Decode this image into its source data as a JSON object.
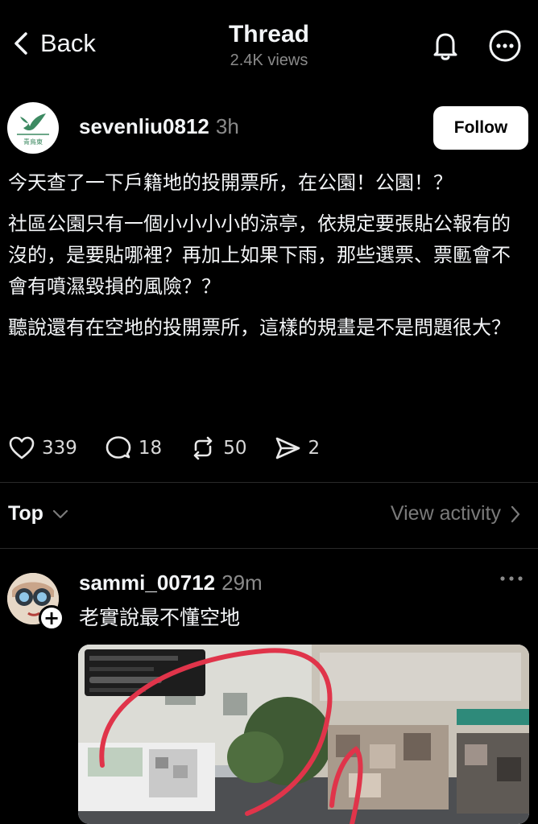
{
  "header": {
    "back_label": "Back",
    "title": "Thread",
    "views": "2.4K views"
  },
  "post": {
    "username": "sevenliu0812",
    "time": "3h",
    "follow_label": "Follow",
    "avatar_text": "青鳥東",
    "paragraphs": [
      "今天查了一下戶籍地的投開票所，在公園！公園！？",
      "社區公園只有一個小小小小的涼亭，依規定要張貼公報有的沒的，是要貼哪裡？再加上如果下雨，那些選票、票匭會不會有噴濕毀損的風險？？",
      "聽說還有在空地的投開票所，這樣的規畫是不是問題很大？"
    ],
    "likes": "339",
    "comments": "18",
    "reposts": "50",
    "shares": "2"
  },
  "sort": {
    "top_label": "Top",
    "view_activity": "View activity"
  },
  "reply": {
    "username": "sammi_00712",
    "time": "29m",
    "text": "老實說最不懂空地"
  },
  "colors": {
    "background": "#000000",
    "text": "#f3f5f7",
    "muted": "#8a8a8a",
    "follow_bg": "#ffffff",
    "avatar_green": "#3d8a62",
    "circle_red": "#e0344a"
  }
}
